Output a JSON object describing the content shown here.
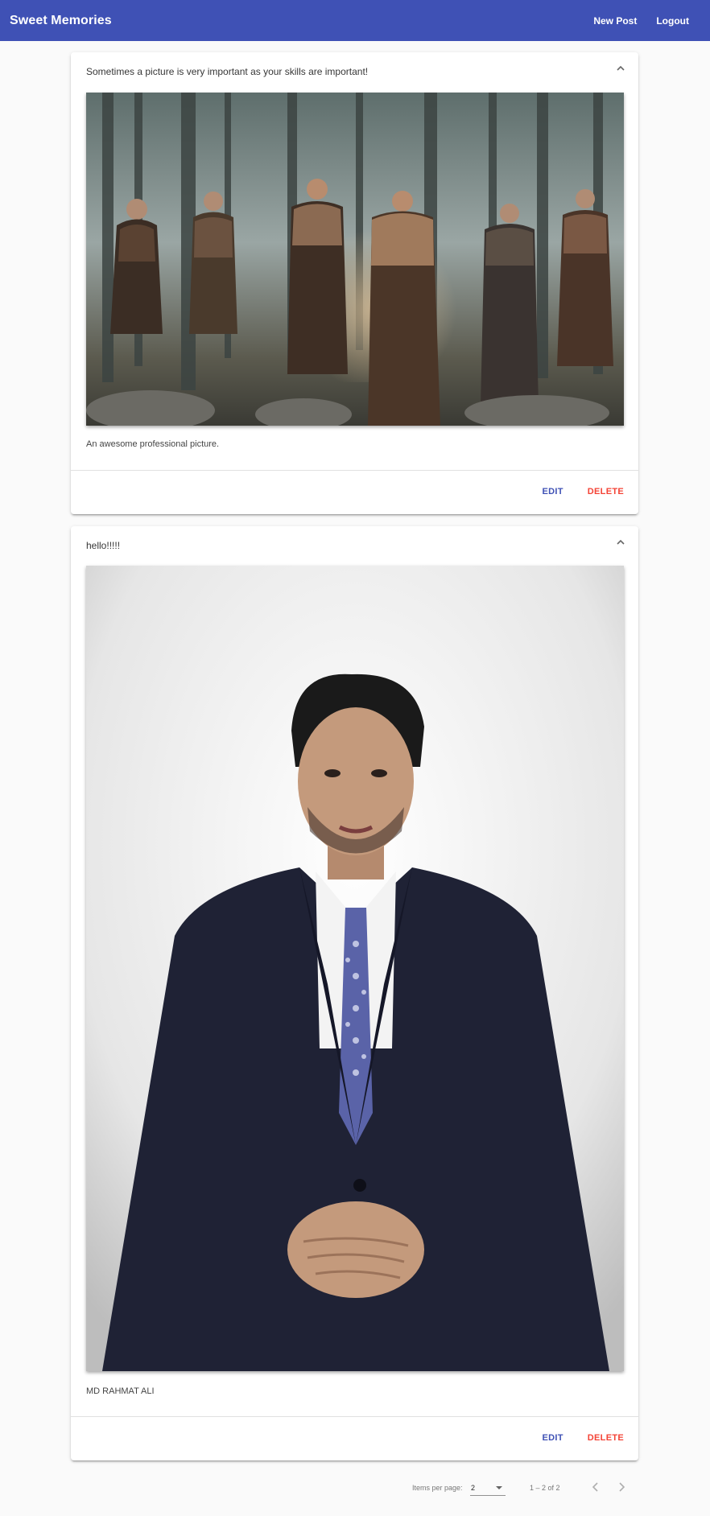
{
  "app": {
    "title": "Sweet Memories",
    "nav": {
      "new_post": "New Post",
      "logout": "Logout"
    }
  },
  "posts": [
    {
      "title": "Sometimes a picture is very important as your skills are important!",
      "image_icon": "warriors-group-photo",
      "content": "An awesome professional picture.",
      "edit_label": "EDIT",
      "delete_label": "DELETE"
    },
    {
      "title": "hello!!!!!",
      "image_icon": "portrait-photo",
      "content": "MD RAHMAT ALI",
      "edit_label": "EDIT",
      "delete_label": "DELETE"
    }
  ],
  "paginator": {
    "items_per_page_label": "Items per page:",
    "page_size": "2",
    "range_label": "1 – 2 of 2"
  },
  "colors": {
    "primary": "#3f51b5",
    "warn": "#f44336"
  }
}
